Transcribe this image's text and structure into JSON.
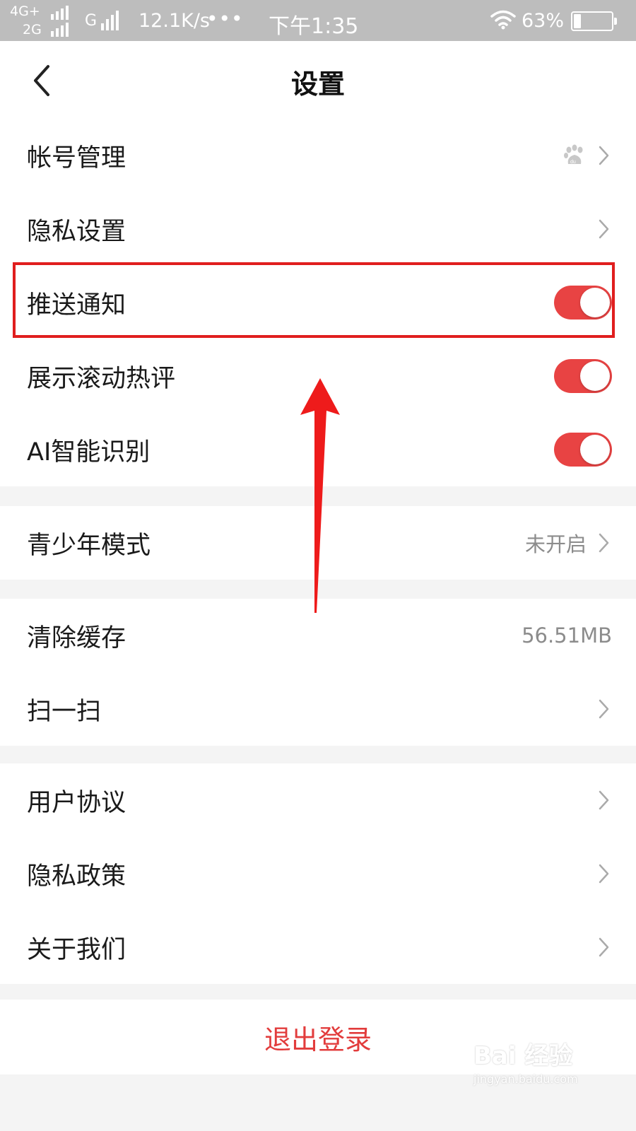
{
  "status_bar": {
    "net1": "4G+",
    "net2": "2G",
    "net3": "G",
    "speed": "12.1K/s",
    "more": "•••",
    "time": "下午1:35",
    "battery": "63%"
  },
  "header": {
    "title": "设置"
  },
  "groups": {
    "account": {
      "account_mgmt": {
        "label": "帐号管理"
      },
      "privacy_settings": {
        "label": "隐私设置"
      },
      "push_notify": {
        "label": "推送通知",
        "enabled": true
      },
      "hot_comments": {
        "label": "展示滚动热评",
        "enabled": true
      },
      "ai_recognition": {
        "label": "AI智能识别",
        "enabled": true
      }
    },
    "teen": {
      "teen_mode": {
        "label": "青少年模式",
        "value": "未开启"
      }
    },
    "tools": {
      "clear_cache": {
        "label": "清除缓存",
        "value": "56.51MB"
      },
      "scan": {
        "label": "扫一扫"
      }
    },
    "legal": {
      "user_agreement": {
        "label": "用户协议"
      },
      "privacy_policy": {
        "label": "隐私政策"
      },
      "about_us": {
        "label": "关于我们"
      }
    }
  },
  "logout": {
    "label": "退出登录"
  },
  "watermark": {
    "main": "Bai 经验",
    "sub": "jingyan.baidu.com"
  },
  "colors": {
    "accent": "#e84343",
    "logout": "#e23c3c",
    "highlight": "#e01e1e"
  },
  "icons": [
    "back-arrow-icon",
    "baidu-paw-icon",
    "chevron-right-icon",
    "wifi-icon",
    "battery-icon",
    "signal-icon"
  ]
}
